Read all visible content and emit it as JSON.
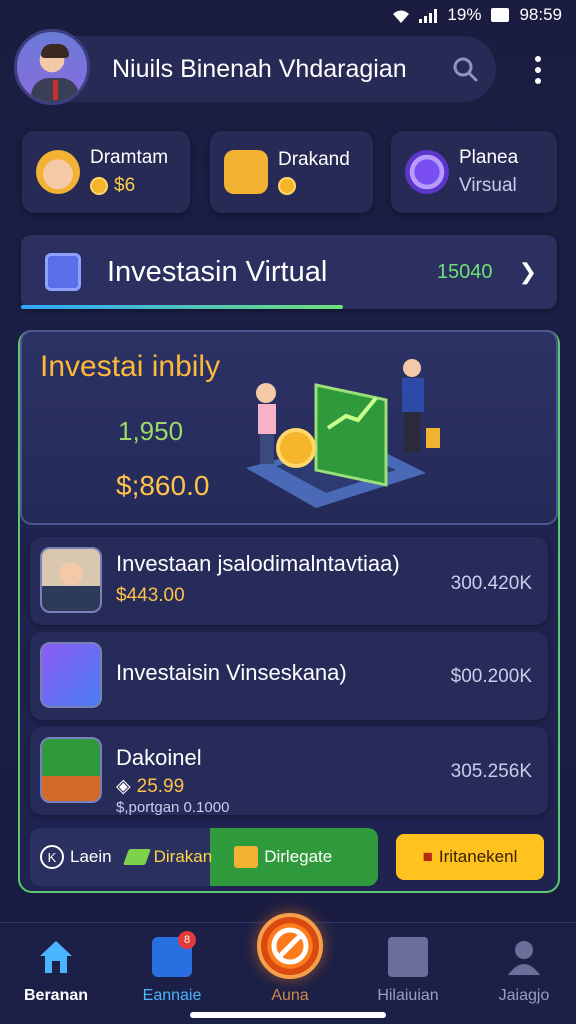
{
  "status_bar": {
    "battery": "19%",
    "time": "98:59"
  },
  "header": {
    "title": "Niuils Binenah Vhdaragian",
    "search_icon": "search-icon",
    "more_icon": "more-vert-icon"
  },
  "quick_cards": [
    {
      "title": "Dramtam",
      "value": "$6",
      "icon": "user-avatar-icon"
    },
    {
      "title": "Drakand",
      "value": "",
      "icon": "chat-bubble-icon"
    },
    {
      "title": "Planea",
      "value": "Virsual",
      "icon": "orb-icon"
    }
  ],
  "investasi_bar": {
    "label": "Investasin Virtual",
    "value": "15040",
    "progress": 0.6
  },
  "hero": {
    "title": "Investai inbily",
    "number": "1,950",
    "money": "$;860.0",
    "illustration": "investment-laptop-illustration"
  },
  "list": [
    {
      "title": "Investaan jsalodimalntavtiaa)",
      "sub": "$443.00",
      "sub2": "",
      "value": "300.420K"
    },
    {
      "title": "Investaisin Vinseskana)",
      "sub": "",
      "sub2": "",
      "value": "$00.200K"
    },
    {
      "title": "Dakoinel",
      "sub": "25.99",
      "sub2": "$,portgan 0.1000",
      "value": "305.256K"
    }
  ],
  "actions": {
    "learn": "Laein",
    "green": "Dirakan",
    "delegate": "Dirlegate",
    "primary": "Iritanekenl"
  },
  "bottom_nav": [
    {
      "label": "Beranan",
      "active": true
    },
    {
      "label": "Eannaie",
      "badge": "8"
    },
    {
      "label": "Auna"
    },
    {
      "label": "Hilaiuian"
    },
    {
      "label": "Jaiagjo"
    }
  ],
  "colors": {
    "background": "#1a1d3f",
    "card": "#262a55",
    "accent_gold": "#ffc24a",
    "accent_green": "#6ee07a",
    "primary_button": "#ffc21f"
  }
}
